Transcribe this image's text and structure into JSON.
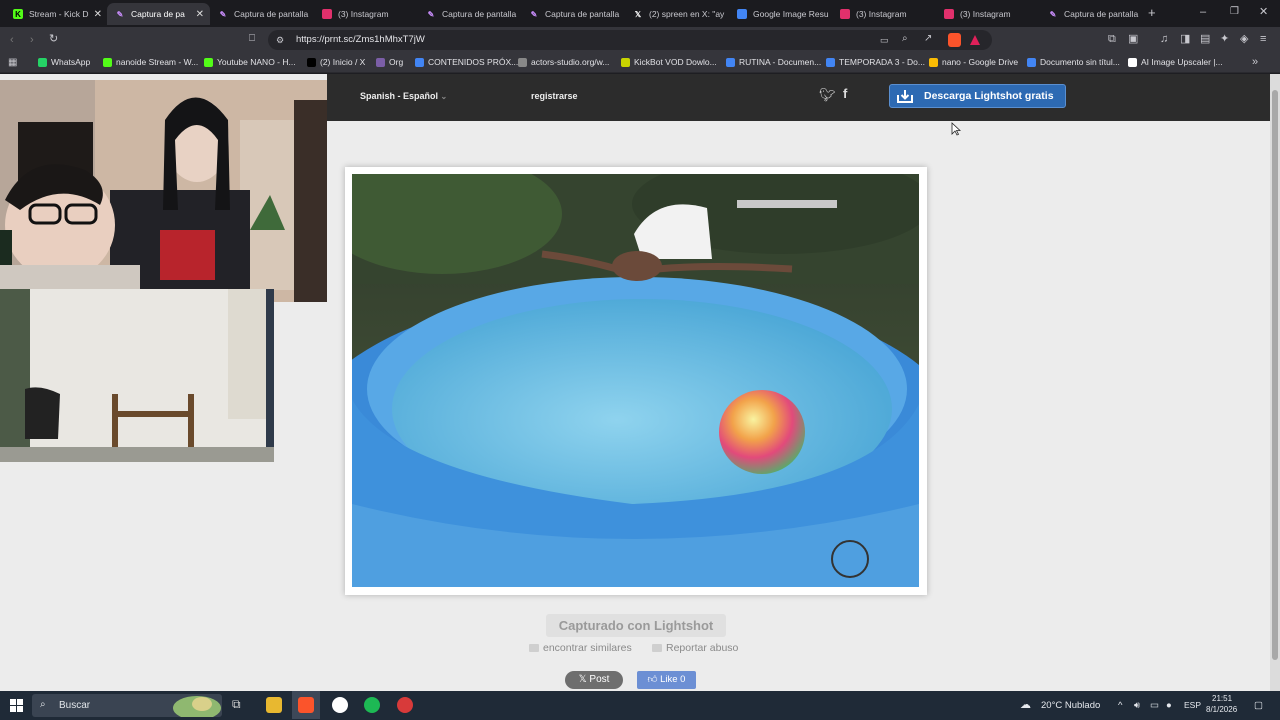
{
  "tabs": [
    {
      "label": "Stream - Kick D",
      "icon": "kick-icon",
      "color": "#53fc18"
    },
    {
      "label": "Captura de pa",
      "icon": "feather-icon",
      "color": "#c48af5",
      "active": true
    },
    {
      "label": "Captura de pantalla",
      "icon": "feather-icon",
      "color": "#c48af5"
    },
    {
      "label": "(3) Instagram",
      "icon": "instagram-icon",
      "color": "#e1306c"
    },
    {
      "label": "Captura de pantalla",
      "icon": "feather-icon",
      "color": "#c48af5"
    },
    {
      "label": "Captura de pantalla",
      "icon": "feather-icon",
      "color": "#c48af5"
    },
    {
      "label": "(2) spreen en X: \"ay",
      "icon": "x-icon",
      "color": "#000000"
    },
    {
      "label": "Google Image Resu",
      "icon": "google-icon",
      "color": "#4285f4"
    },
    {
      "label": "(3) Instagram",
      "icon": "instagram-icon",
      "color": "#e1306c"
    },
    {
      "label": "(3) Instagram",
      "icon": "instagram-icon",
      "color": "#e1306c"
    },
    {
      "label": "Captura de pantalla",
      "icon": "feather-icon",
      "color": "#c48af5"
    }
  ],
  "address": {
    "url": "https://prnt.sc/Zms1hMhxT7jW"
  },
  "bookmarks": [
    {
      "label": "WhatsApp",
      "color": "#25d366"
    },
    {
      "label": "nanoide Stream - W...",
      "color": "#53fc18"
    },
    {
      "label": "Youtube NANO - H...",
      "color": "#53fc18"
    },
    {
      "label": "(2) Inicio / X",
      "color": "#000000"
    },
    {
      "label": "Org",
      "color": "#7b5ea7"
    },
    {
      "label": "CONTENIDOS PRÓX...",
      "color": "#4285f4"
    },
    {
      "label": "actors-studio.org/w...",
      "color": "#888888"
    },
    {
      "label": "KickBot VOD Dowlo...",
      "color": "#c8d400"
    },
    {
      "label": "RUTINA - Documen...",
      "color": "#4285f4"
    },
    {
      "label": "TEMPORADA 3 - Do...",
      "color": "#4285f4"
    },
    {
      "label": "nano - Google Drive",
      "color": "#fbbc04"
    },
    {
      "label": "Documento sin títul...",
      "color": "#4285f4"
    },
    {
      "label": "AI Image Upscaler |...",
      "color": "#ffffff"
    }
  ],
  "site": {
    "language": "Spanish - Español",
    "register": "registrarse",
    "download_button": "Descarga Lightshot gratis",
    "captured_with": "Capturado con Lightshot",
    "find_similar": "encontrar similares",
    "report_abuse": "Reportar abuso",
    "post_button": "Post",
    "like_button": "Like 0"
  },
  "taskbar": {
    "search_placeholder": "Buscar",
    "weather": "20°C  Nublado",
    "language": "ESP",
    "time": "21:51",
    "date": "8/1/2026"
  },
  "colors": {
    "accent": "#2d6ab3",
    "page_bg": "#ececec",
    "site_header": "#2c2c2c"
  }
}
